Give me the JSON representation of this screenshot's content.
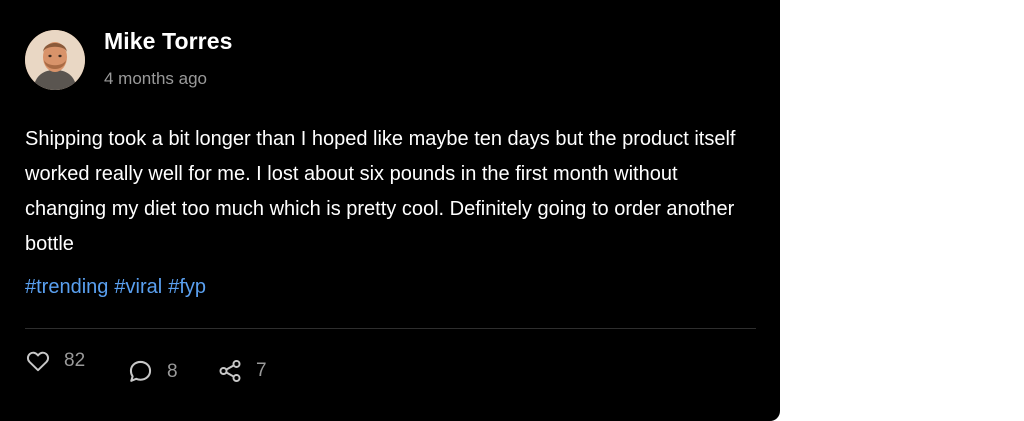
{
  "post": {
    "author": "Mike Torres",
    "time": "4 months ago",
    "body": "Shipping took a bit longer than I hoped like maybe ten days but the product itself worked really well for me. I lost about six pounds in the first month without changing my diet too much which is pretty cool. Definitely going to order another bottle",
    "tags": [
      "#trending",
      "#viral",
      "#fyp"
    ]
  },
  "actions": {
    "likes": "82",
    "comments": "8",
    "shares": "7"
  },
  "colors": {
    "card_bg": "#000000",
    "text": "#ffffff",
    "muted": "#9a9a9a",
    "hashtag": "#5aa0f0"
  },
  "icons": {
    "like": "heart-icon",
    "comment": "speech-bubble-icon",
    "share": "share-icon"
  }
}
